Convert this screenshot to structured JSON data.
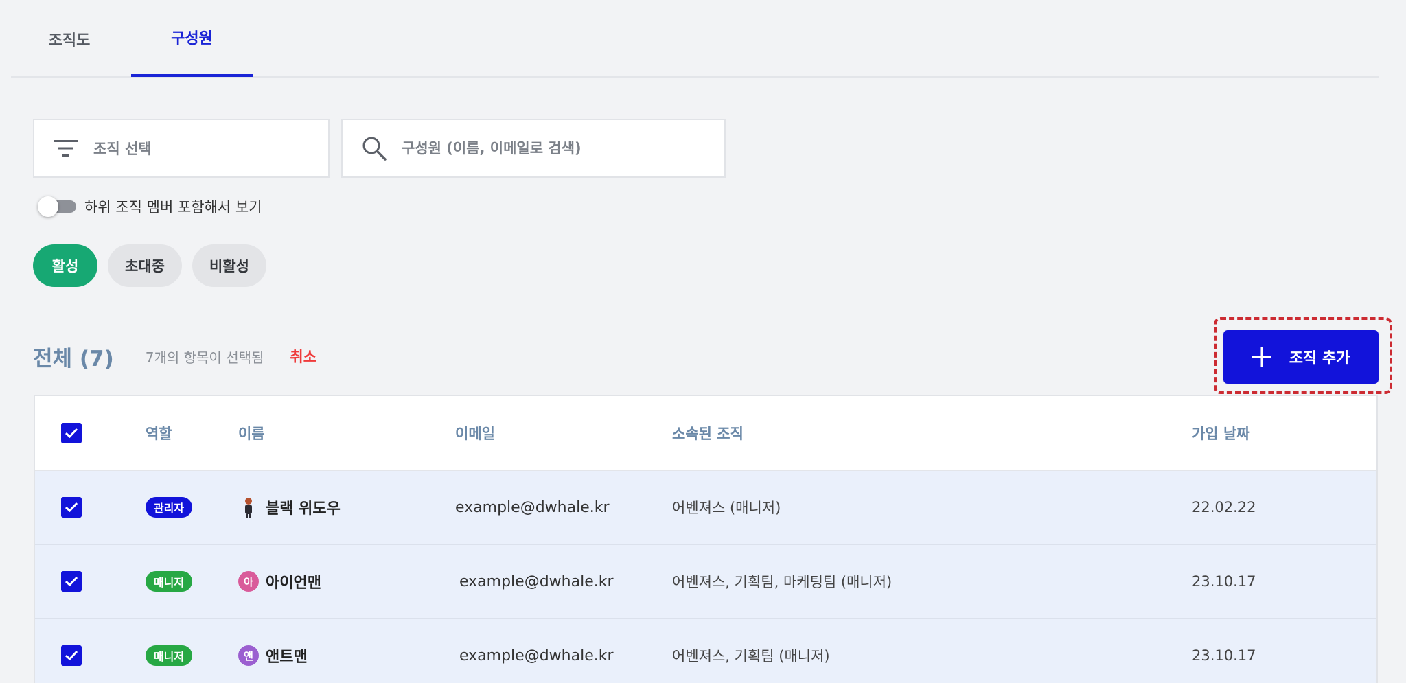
{
  "tabs": [
    {
      "label": "조직도"
    },
    {
      "label": "구성원"
    }
  ],
  "filters": {
    "org_select_placeholder": "조직 선택",
    "search_placeholder": "구성원 (이름, 이메일로 검색)"
  },
  "toggle": {
    "label": "하위 조직 멤버 포함해서 보기",
    "on": false
  },
  "status_pills": [
    {
      "label": "활성",
      "active": true
    },
    {
      "label": "초대중",
      "active": false
    },
    {
      "label": "비활성",
      "active": false
    }
  ],
  "summary": {
    "total": "전체 (7)",
    "selected": "7개의 항목이 선택됨",
    "cancel": "취소"
  },
  "add_button": {
    "label": "조직 추가"
  },
  "table": {
    "headers": {
      "role": "역할",
      "name": "이름",
      "email": "이메일",
      "org": "소속된 조직",
      "date": "가입 날짜"
    },
    "rows": [
      {
        "role": "관리자",
        "role_type": "admin",
        "avatar": "",
        "name": "블랙 위도우",
        "email": "example@dwhale.kr",
        "org": "어벤져스 (매니저)",
        "date": "22.02.22"
      },
      {
        "role": "매니저",
        "role_type": "manager",
        "avatar": "아",
        "name": "아이언맨",
        "email": "example@dwhale.kr",
        "org": "어벤져스, 기획팀, 마케팅팀 (매니저)",
        "date": "23.10.17"
      },
      {
        "role": "매니저",
        "role_type": "manager",
        "avatar": "앤",
        "name": "앤트맨",
        "email": "example@dwhale.kr",
        "org": "어벤져스, 기획팀 (매니저)",
        "date": "23.10.17"
      }
    ]
  },
  "colors": {
    "accent": "#1213da",
    "active_pill": "#17a873",
    "danger": "#ef3b3b",
    "header_text": "#6a88a8",
    "selected_row": "#eaf0fb"
  },
  "icons": {
    "filter": "filter-icon",
    "search": "search-icon",
    "plus": "plus-icon",
    "check": "check-icon"
  }
}
